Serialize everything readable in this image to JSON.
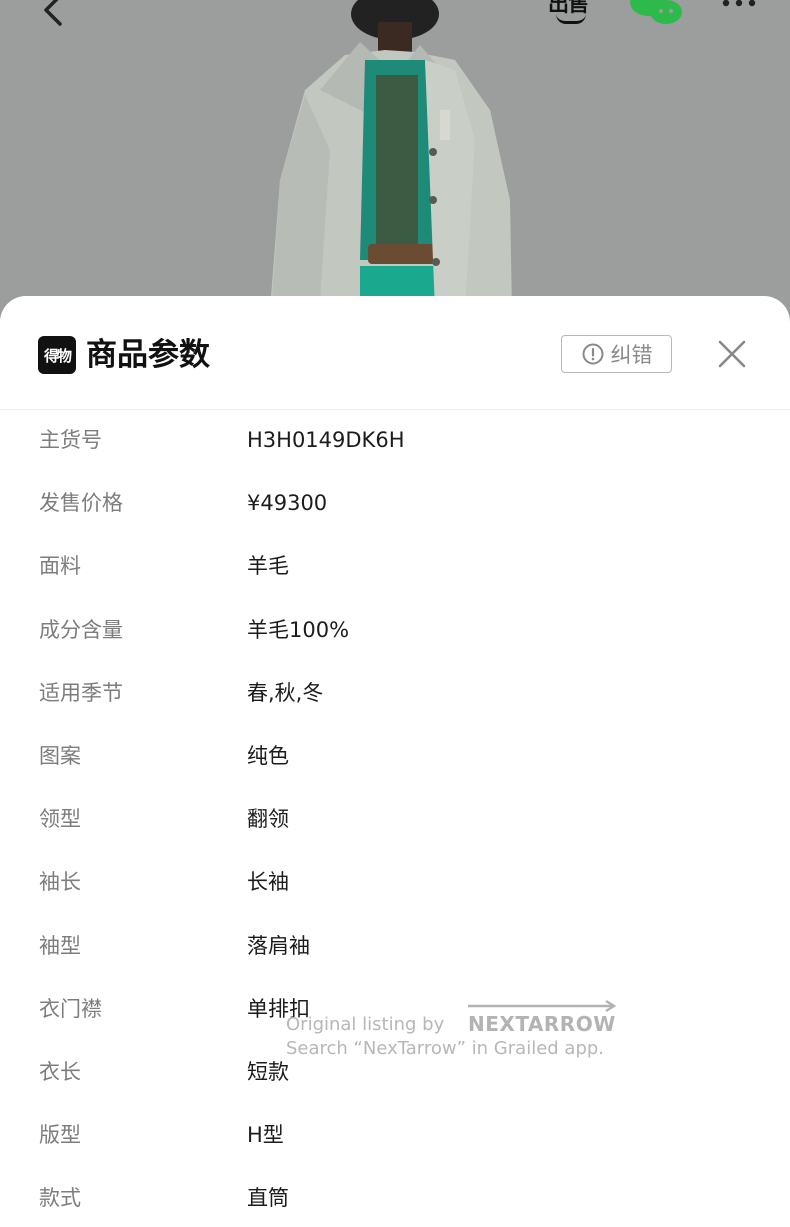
{
  "header": {
    "share_logo_text": "出售",
    "icons": [
      "back-arrow-icon",
      "share-logo-icon",
      "wechat-icon",
      "more-icon"
    ]
  },
  "sheet": {
    "brand_logo_text": "得物",
    "title": "商品参数",
    "report_button_label": "纠错",
    "report_icon": "alert-circle-icon",
    "close_icon": "close-icon"
  },
  "params": [
    {
      "label": "主货号",
      "value": "H3H0149DK6H"
    },
    {
      "label": "发售价格",
      "value": "¥49300"
    },
    {
      "label": "面料",
      "value": "羊毛"
    },
    {
      "label": "成分含量",
      "value": "羊毛100%"
    },
    {
      "label": "适用季节",
      "value": "春,秋,冬"
    },
    {
      "label": "图案",
      "value": "纯色"
    },
    {
      "label": "领型",
      "value": "翻领"
    },
    {
      "label": "袖长",
      "value": "长袖"
    },
    {
      "label": "袖型",
      "value": "落肩袖"
    },
    {
      "label": "衣门襟",
      "value": "单排扣"
    },
    {
      "label": "衣长",
      "value": "短款"
    },
    {
      "label": "版型",
      "value": "H型"
    },
    {
      "label": "款式",
      "value": "直筒"
    }
  ],
  "watermark": {
    "line1": "Original listing by",
    "brand": "NEXTARROW",
    "line2": "Search “NexTarrow” in Grailed app."
  },
  "colors": {
    "overlay": "#9c9e9d",
    "sheet_bg": "#ffffff",
    "label_text": "#7d7d7d",
    "value_text": "#1c1c1c",
    "wechat_green": "#2dba4a",
    "teal_sweater": "#1e8a78"
  }
}
